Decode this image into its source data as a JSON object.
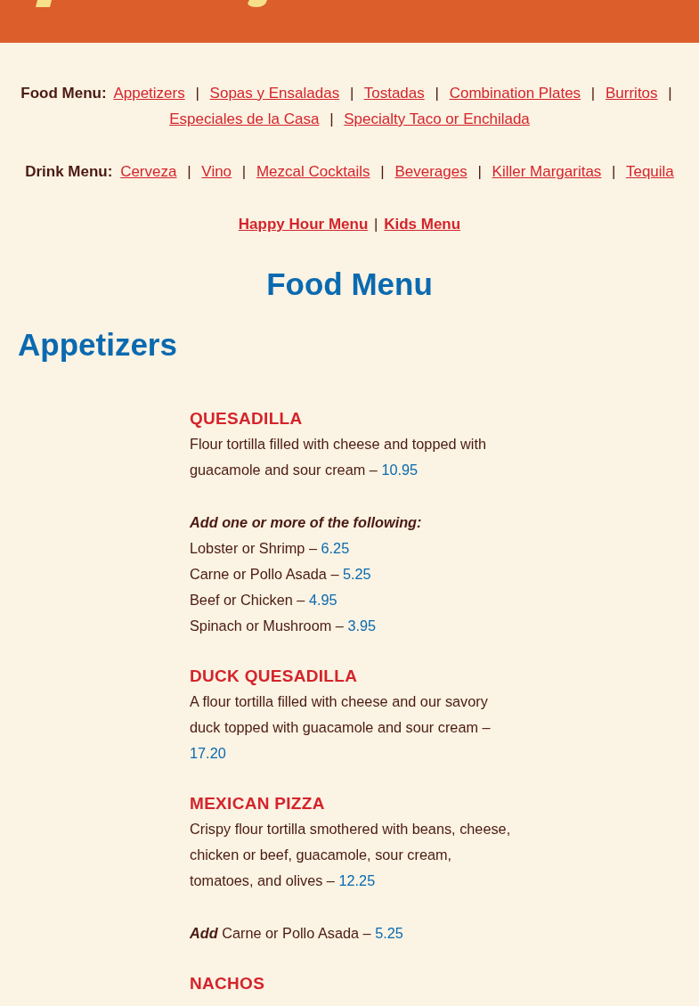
{
  "nav": [
    {
      "kind": "plain",
      "label": "Food Menu:",
      "separator": "|",
      "links": [
        "Appetizers",
        "Sopas y Ensaladas",
        "Tostadas",
        "Combination Plates",
        "Burritos",
        "Especiales de la Casa",
        "Specialty Taco or Enchilada"
      ]
    },
    {
      "kind": "plain",
      "label": "Drink Menu:",
      "separator": "|",
      "links": [
        "Cerveza",
        "Vino",
        "Mezcal Cocktails",
        "Beverages",
        "Killer Margaritas",
        "Tequila"
      ]
    },
    {
      "kind": "bold",
      "separator": "|",
      "links": [
        "Happy Hour Menu",
        "Kids Menu"
      ]
    }
  ],
  "page_title": "Food Menu",
  "section_title": "Appetizers",
  "entries": [
    {
      "kind": "item",
      "name": "QUESADILLA",
      "description": "Flour tortilla filled with cheese and topped with guacamole and sour cream –",
      "price": "10.95"
    },
    {
      "kind": "addon_header",
      "text": "Add one or more of the following:"
    },
    {
      "kind": "addon",
      "text": "Lobster or Shrimp –",
      "price": "6.25"
    },
    {
      "kind": "addon",
      "text": "Carne or Pollo Asada –",
      "price": "5.25"
    },
    {
      "kind": "addon",
      "text": "Beef or Chicken –",
      "price": "4.95"
    },
    {
      "kind": "addon",
      "text": "Spinach or Mushroom –",
      "price": "3.95"
    },
    {
      "kind": "item",
      "name": "DUCK QUESADILLA",
      "description": "A flour tortilla filled with cheese and our savory duck topped with guacamole and sour cream –",
      "price": "17.20"
    },
    {
      "kind": "item",
      "name": "MEXICAN PIZZA",
      "description": "Crispy flour tortilla smothered with beans, cheese, chicken or beef, guacamole, sour cream, tomatoes, and olives –",
      "price": "12.25"
    },
    {
      "kind": "add_line",
      "lead": "Add",
      "text": "Carne or Pollo Asada –",
      "price": "5.25"
    },
    {
      "kind": "item",
      "name": "NACHOS"
    }
  ]
}
